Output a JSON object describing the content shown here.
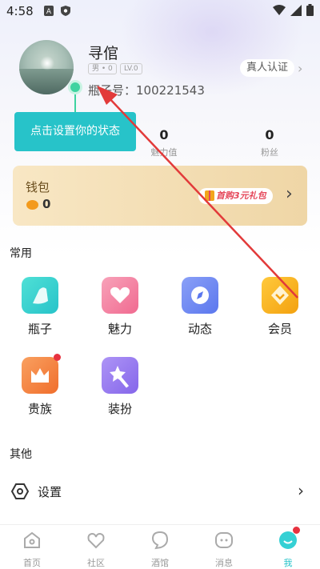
{
  "status_bar": {
    "time": "4:58"
  },
  "profile": {
    "username": "寻倌",
    "gender_tag": "男 • 0",
    "level_tag": "LV.0",
    "bottle_id": "瓶子号：100221543",
    "verify_label": "真人认证"
  },
  "tooltip": {
    "text": "点击设置你的状态"
  },
  "stats": [
    {
      "value": "0",
      "label": "魅力值"
    },
    {
      "value": "0",
      "label": "粉丝"
    }
  ],
  "wallet": {
    "title": "钱包",
    "balance": "0",
    "promo": "首购3元礼包"
  },
  "common": {
    "title": "常用",
    "items": [
      {
        "label": "瓶子",
        "icon": "bottle-icon",
        "color": "#2fd1c8"
      },
      {
        "label": "魅力",
        "icon": "heart-icon",
        "color": "#f47ea0"
      },
      {
        "label": "动态",
        "icon": "compass-icon",
        "color": "#6f8bf3"
      },
      {
        "label": "会员",
        "icon": "vip-icon",
        "color": "#f5b21b"
      },
      {
        "label": "贵族",
        "icon": "crown-icon",
        "color": "#f4823f"
      },
      {
        "label": "装扮",
        "icon": "magic-wand-icon",
        "color": "#9a7cf0"
      }
    ]
  },
  "other": {
    "title": "其他",
    "settings_label": "设置"
  },
  "bottom_nav": [
    {
      "label": "首页",
      "icon": "home-icon"
    },
    {
      "label": "社区",
      "icon": "community-icon"
    },
    {
      "label": "酒馆",
      "icon": "tavern-icon"
    },
    {
      "label": "消息",
      "icon": "message-icon"
    },
    {
      "label": "我",
      "icon": "me-icon",
      "active": true
    }
  ],
  "colors": {
    "accent": "#27c3c9",
    "badge_red": "#e7323f",
    "arrow_red": "#e23a3a"
  }
}
